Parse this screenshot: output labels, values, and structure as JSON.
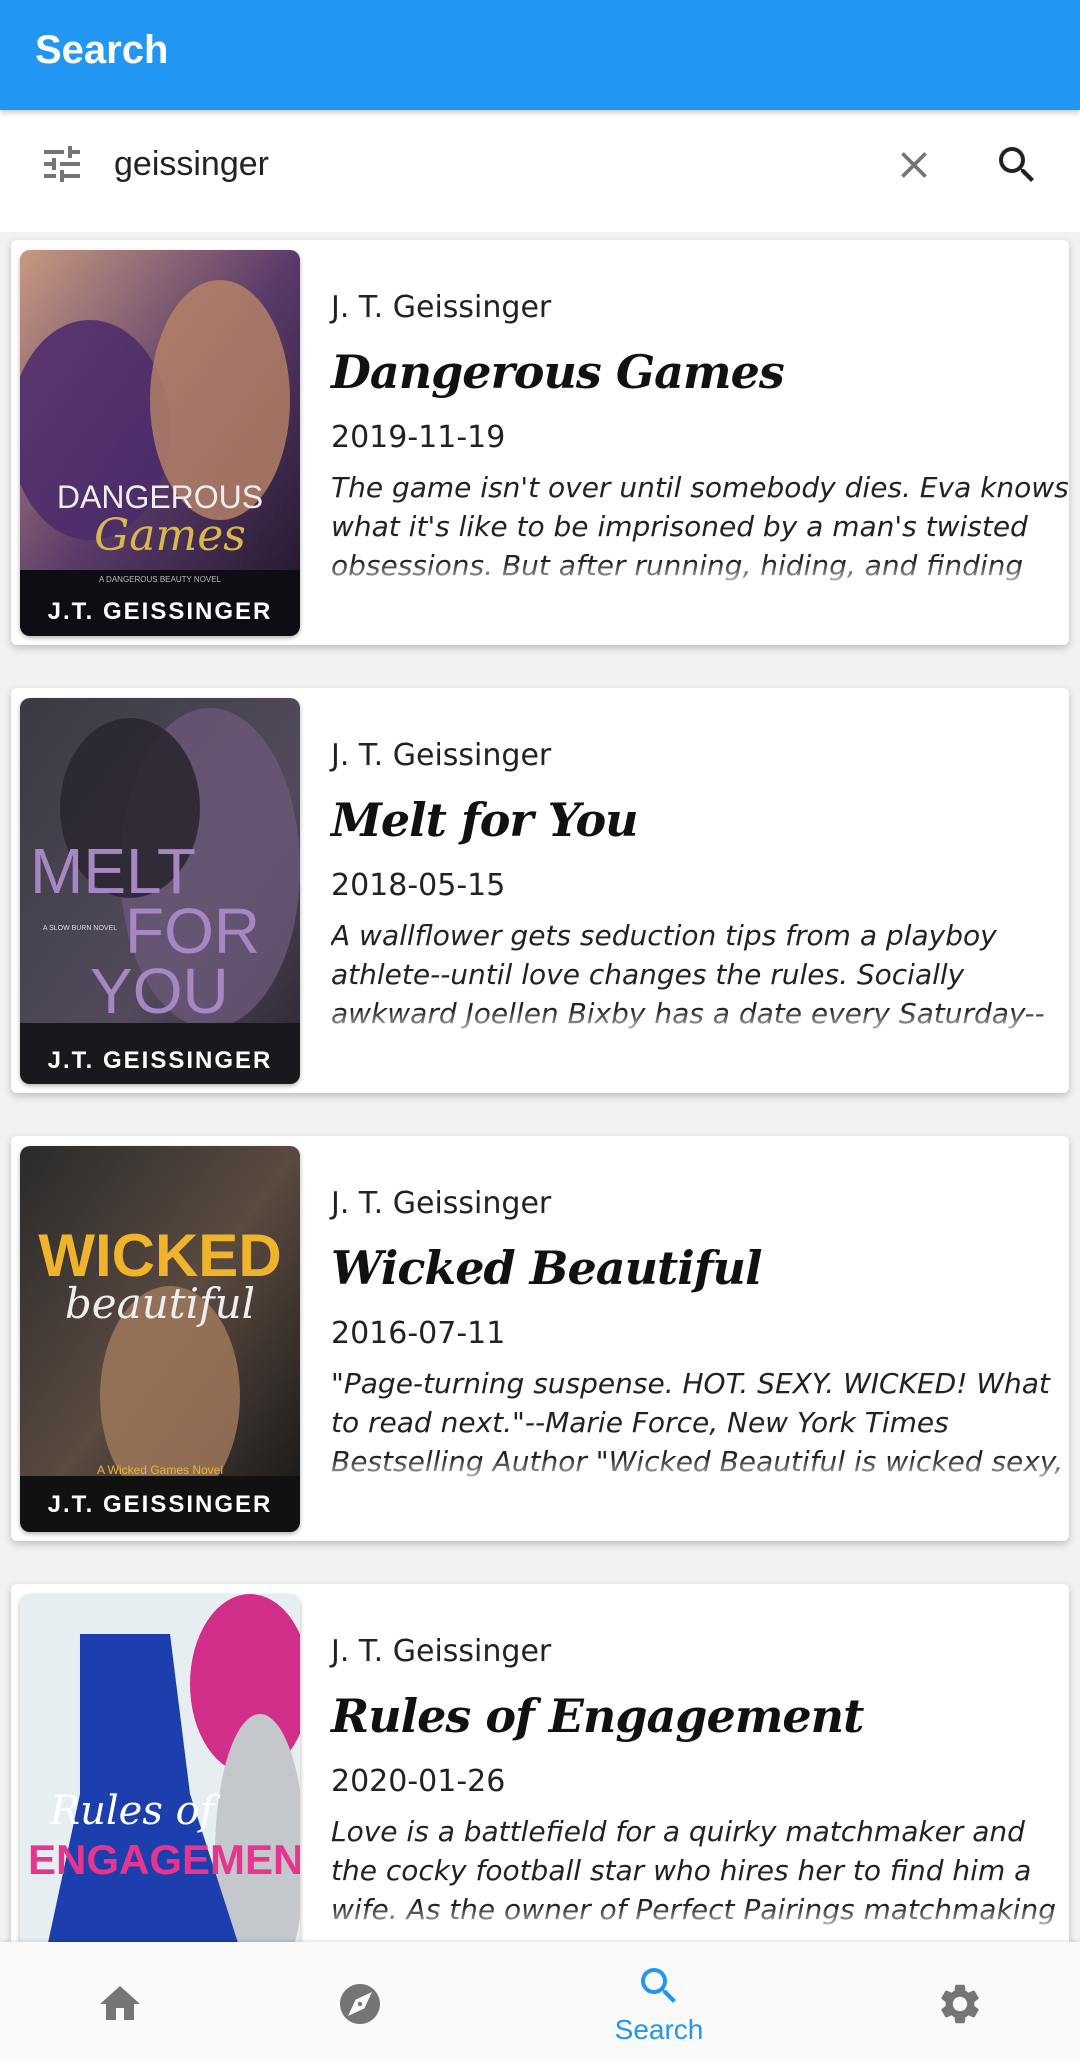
{
  "app_bar": {
    "title": "Search"
  },
  "search": {
    "value": "geissinger"
  },
  "results": [
    {
      "author": "J. T. Geissinger",
      "title": "Dangerous Games",
      "date": "2019-11-19",
      "description": "The game isn't over until somebody dies. Eva knows what it's like to be imprisoned by a man's twisted obsessions. But after running, hiding, and finding refuge in a rescuer's arms, she learns she is pulled back into the dark shadow of her past...",
      "cover": {
        "line1": "DANGEROUS",
        "line2": "Games",
        "tagline": "A DANGEROUS BEAUTY NOVEL",
        "author": "J.T. GEISSINGER"
      }
    },
    {
      "author": "J. T. Geissinger",
      "title": "Melt for You",
      "date": "2018-05-15",
      "description": "A wallflower gets seduction tips from a playboy athlete--until love changes the rules. Socially awkward Joellen Bixby has a date every Saturday--with her cat, a pint of ice cream, and reruns of the same show she adores. Michael...",
      "cover": {
        "line1": "MELT",
        "line2": "FOR",
        "line3": "YOU",
        "tagline": "A SLOW BURN NOVEL",
        "author": "J.T. GEISSINGER"
      }
    },
    {
      "author": "J. T. Geissinger",
      "title": "Wicked Beautiful",
      "date": "2016-07-11",
      "description": "\"Page-turning suspense. HOT. SEXY. WICKED! What to read next.\"--Marie Force, New York Times Bestselling Author \"Wicked Beautiful is wicked sexy, wicked emotional, and wonderfully romantic!\"--NYT Bestselling Author, Jennifer...",
      "cover": {
        "line1": "WICKED",
        "line2": "beautiful",
        "tagline": "A Wicked Games Novel",
        "author": "J.T. GEISSINGER"
      }
    },
    {
      "author": "J. T. Geissinger",
      "title": "Rules of Engagement",
      "date": "2020-01-26",
      "description": "Love is a battlefield for a quirky matchmaker and the cocky football star who hires her to find him a wife. As the owner of Perfect Pairings matchmaking service, Maddie McRae spends her life helping others fall in love, even though...",
      "cover": {
        "line1": "Rules of",
        "line2": "ENGAGEMENT"
      }
    }
  ],
  "bottom_nav": {
    "items": [
      {
        "icon": "home-icon"
      },
      {
        "icon": "compass-icon"
      },
      {
        "icon": "search-icon",
        "label": "Search",
        "active": true
      },
      {
        "icon": "gear-icon"
      }
    ]
  },
  "colors": {
    "primary": "#2196F3",
    "icon_grey": "#757575"
  }
}
